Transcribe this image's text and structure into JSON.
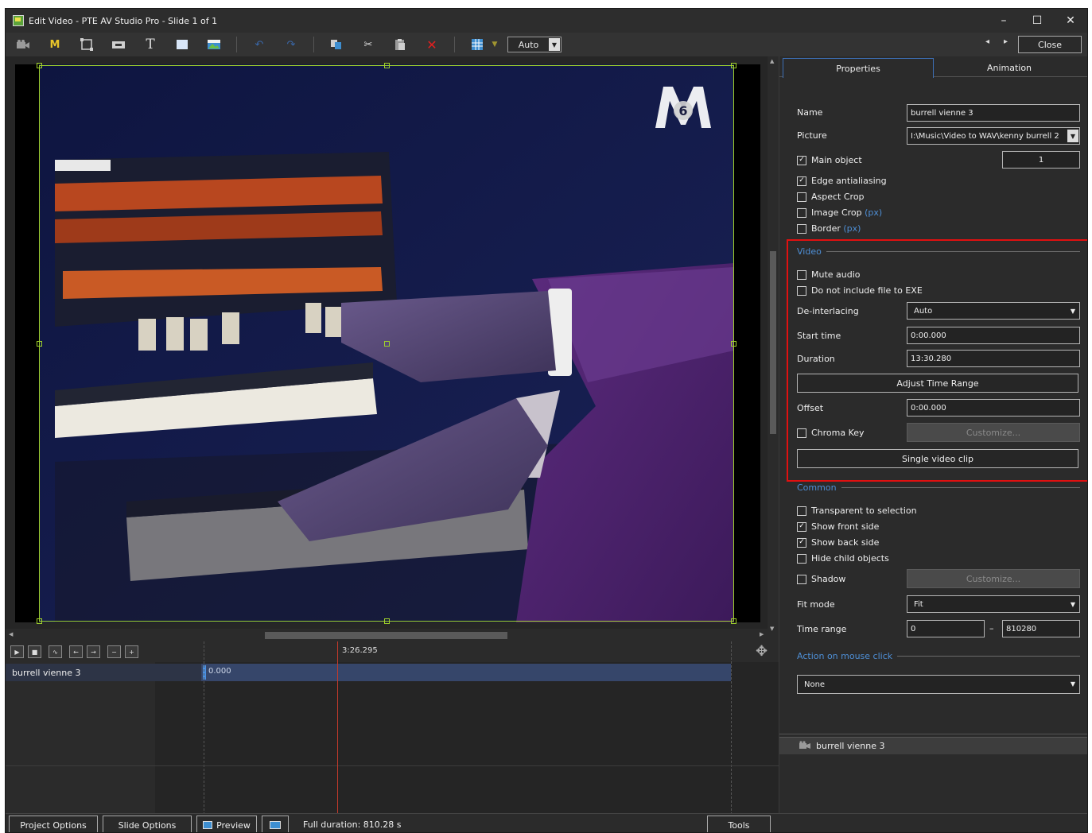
{
  "window": {
    "title": "Edit Video - PTE AV Studio Pro - Slide 1 of 1",
    "minimize": "–",
    "maximize": "☐",
    "close": "✕"
  },
  "toolbar": {
    "zoom_value": "Auto",
    "close_label": "Close",
    "prev_arrow": "◂",
    "next_arrow": "▸"
  },
  "video": {
    "logo_text": "M6"
  },
  "timeline": {
    "current_time": "3:26.295",
    "track_name": "burrell vienne 3",
    "clip_start": "0.000"
  },
  "bottom": {
    "project_options": "Project Options",
    "slide_options": "Slide Options",
    "preview": "Preview",
    "full_duration": "Full duration: 810.28 s",
    "tools": "Tools"
  },
  "panel": {
    "tabs": [
      "Properties",
      "Animation"
    ],
    "name_label": "Name",
    "name_value": "burrell vienne 3",
    "picture_label": "Picture",
    "picture_value": "I:\\Music\\Video to WAV\\kenny burrell 2",
    "main_object_label": "Main object",
    "main_object_value": "1",
    "edge_antialiasing": "Edge antialiasing",
    "aspect_crop": "Aspect Crop",
    "image_crop": "Image Crop",
    "border": "Border",
    "px": "(px)",
    "video_section": "Video",
    "mute_audio": "Mute audio",
    "do_not_include": "Do not include file to EXE",
    "deinterlacing_label": "De-interlacing",
    "deinterlacing_value": "Auto",
    "start_time_label": "Start time",
    "start_time_value": "0:00.000",
    "duration_label": "Duration",
    "duration_value": "13:30.280",
    "adjust_time_range": "Adjust Time Range",
    "offset_label": "Offset",
    "offset_value": "0:00.000",
    "chroma_key": "Chroma Key",
    "customize": "Customize...",
    "single_video_clip": "Single video clip",
    "common_section": "Common",
    "transparent_to_selection": "Transparent to selection",
    "show_front_side": "Show front side",
    "show_back_side": "Show back side",
    "hide_child_objects": "Hide child objects",
    "shadow": "Shadow",
    "fit_mode_label": "Fit mode",
    "fit_mode_value": "Fit",
    "time_range_label": "Time range",
    "time_range_from": "0",
    "time_range_dash": "–",
    "time_range_to": "810280",
    "action_section": "Action on mouse click",
    "action_value": "None",
    "object_list_item": "burrell vienne 3"
  },
  "colors": {
    "accent_blue": "#4e8fd6",
    "highlight_red": "#e01010",
    "selection_green": "#9fd12a",
    "playhead_red": "#c0392b"
  }
}
